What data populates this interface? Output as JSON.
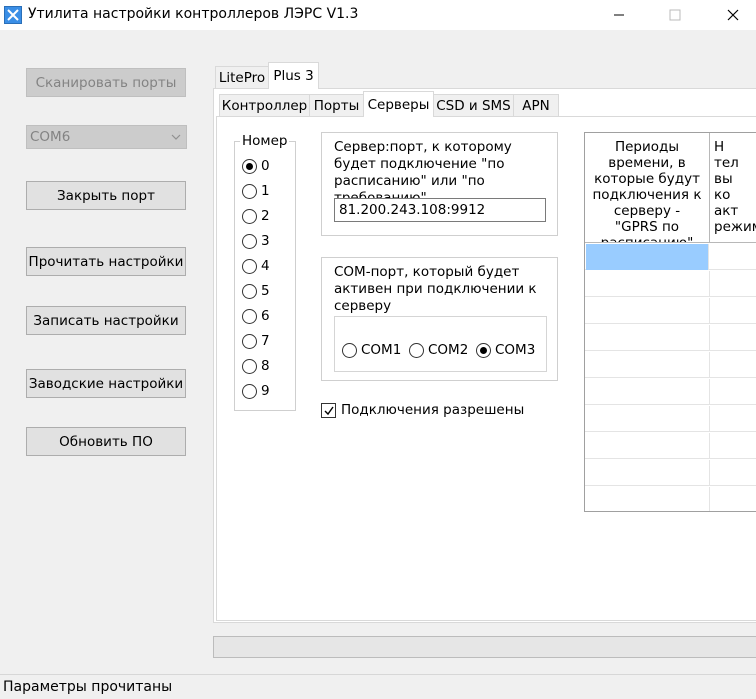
{
  "window": {
    "title": "Утилита настройки контроллеров ЛЭРС V1.3"
  },
  "left_panel": {
    "scan_ports_label": "Сканировать порты",
    "port_selected": "COM6",
    "close_port_label": "Закрыть порт",
    "read_settings_label": "Прочитать настройки",
    "write_settings_label": "Записать настройки",
    "factory_settings_label": "Заводские настройки",
    "update_fw_label": "Обновить ПО"
  },
  "outer_tabs": [
    "LitePro",
    "Plus 3"
  ],
  "inner_tabs": [
    "Контроллер",
    "Порты",
    "Серверы",
    "CSD и SMS",
    "APN"
  ],
  "servers": {
    "number_title": "Номер",
    "numbers": [
      "0",
      "1",
      "2",
      "3",
      "4",
      "5",
      "6",
      "7",
      "8",
      "9"
    ],
    "selected_number": 0,
    "server_port_title": "Сервер:порт, к которому будет подключение \"по расписанию\" или \"по требованию\"",
    "server_port_value": "81.200.243.108:9912",
    "com_port_title": "COM-порт, который будет активен при подключении к серверу",
    "com_options": [
      "COM1",
      "COM2",
      "COM3"
    ],
    "com_selected": 2,
    "connections_allowed_label": "Подключения разрешены",
    "connections_allowed": true
  },
  "grid": {
    "col1_header": "Периоды времени, в которые будут подключения к серверу - \"GPRS по расписанию\"",
    "col2_header": "Н\nтел\nвы\nко\nакт\nрежим"
  },
  "status": {
    "text": "Параметры прочитаны"
  },
  "colors": {
    "selection": "#99ccff",
    "disabled_bg": "#cccccc",
    "button_bg": "#e1e1e1"
  }
}
